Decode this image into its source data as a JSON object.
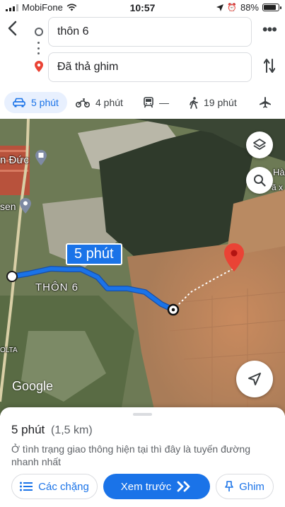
{
  "status_bar": {
    "carrier": "MobiFone",
    "time": "10:57",
    "battery": "88%",
    "battery_level": 0.88
  },
  "route": {
    "origin": "thôn 6",
    "destination": "Đã thả ghim"
  },
  "modes": [
    {
      "icon": "car-icon",
      "label": "5 phút",
      "active": true
    },
    {
      "icon": "motorbike-icon",
      "label": "4 phút",
      "active": false
    },
    {
      "icon": "transit-icon",
      "label": "—",
      "active": false
    },
    {
      "icon": "walk-icon",
      "label": "19 phút",
      "active": false
    },
    {
      "icon": "flight-icon",
      "label": "",
      "active": false
    }
  ],
  "map": {
    "eta_label": "5 phút",
    "place_labels": [
      "n Đức",
      "THÔN 6",
      "sen",
      "Hàn",
      "ã x",
      "OLTA"
    ],
    "attribution": "Google",
    "route_color": "#1a73e8",
    "pin_color": "#ea4335"
  },
  "sheet": {
    "duration": "5 phút",
    "distance": "(1,5 km)",
    "description": "Ở tình trạng giao thông hiện tại thì đây là tuyến đường nhanh nhất",
    "steps_button": "Các chặng",
    "preview_button": "Xem trước",
    "pin_button": "Ghim"
  }
}
